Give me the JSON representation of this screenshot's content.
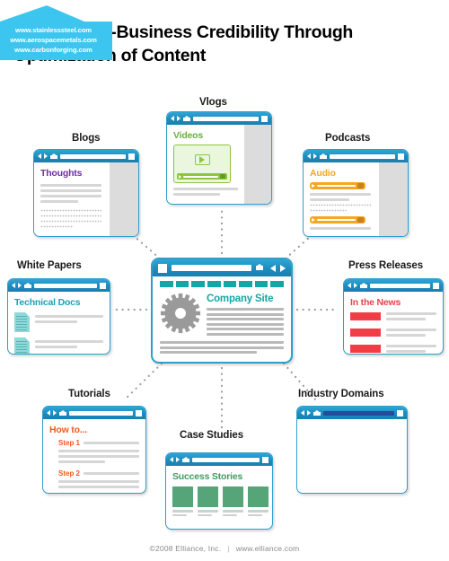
{
  "title": "Business-to-Business Credibility Through Optimization of Content",
  "footer": {
    "copyright": "©2008 Elliance, Inc.",
    "separator": "|",
    "site": "www.elliance.com"
  },
  "center": {
    "label": "Company Site",
    "icons": {
      "window": "square-icon",
      "address": "address-bar",
      "home": "home-icon",
      "back": "back-arrow-icon",
      "forward": "forward-arrow-icon",
      "gear": "gear-icon"
    },
    "accent": "#16a5a5"
  },
  "nodes": [
    {
      "id": "blogs",
      "label": "Blogs",
      "heading": "Thoughts",
      "accent": "#6f2fa0"
    },
    {
      "id": "vlogs",
      "label": "Vlogs",
      "heading": "Videos",
      "accent": "#6ab13f",
      "player": "video-player-icon"
    },
    {
      "id": "podcasts",
      "label": "Podcasts",
      "heading": "Audio",
      "accent": "#f5a623",
      "player": "audio-player-icon"
    },
    {
      "id": "white-papers",
      "label": "White Papers",
      "heading": "Technical Docs",
      "accent": "#17a2b8",
      "doc_icon": "document-icon"
    },
    {
      "id": "press-releases",
      "label": "Press Releases",
      "heading": "In the News",
      "accent": "#e8414a"
    },
    {
      "id": "tutorials",
      "label": "Tutorials",
      "heading": "How to...",
      "accent": "#f05a22",
      "steps": [
        "Step 1",
        "Step 2"
      ]
    },
    {
      "id": "case-studies",
      "label": "Case Studies",
      "heading": "Success Stories",
      "accent": "#3f9a63"
    },
    {
      "id": "industry-domains",
      "label": "Industry Domains",
      "accent": "#3cc6ef",
      "domains": [
        "www.stainlesssteel.com",
        "www.aerospacemetals.com",
        "www.carbonforging.com"
      ]
    }
  ],
  "colors": {
    "browser_chrome": "#1d8cbd",
    "connector": "#9b9b9b",
    "text": "#1a1a1a",
    "footer": "#8b8b8b"
  }
}
